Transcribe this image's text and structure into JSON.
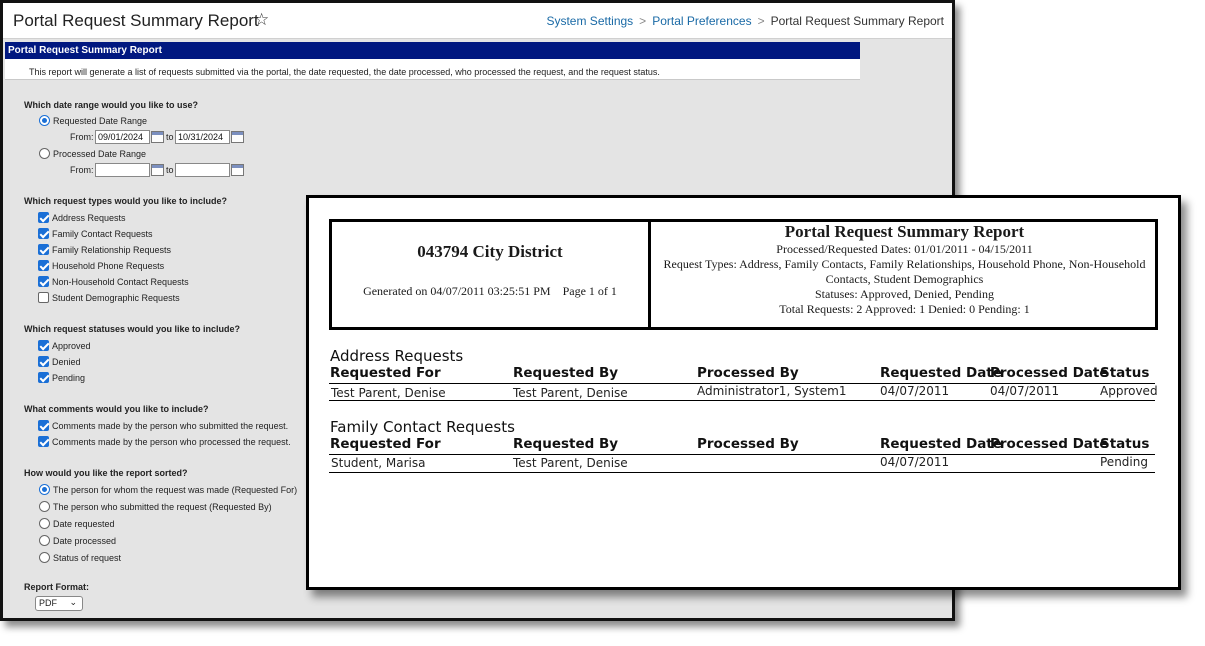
{
  "form_window": {
    "title": "Portal Request Summary Report",
    "star_icon": "star-outline-icon",
    "breadcrumb": [
      "System Settings",
      "Portal Preferences",
      "Portal Request Summary Report"
    ],
    "panel_title": "Portal Request Summary Report",
    "description": "This report will generate a list of requests submitted via the portal, the date requested, the date processed, who processed the request, and the request status.",
    "date_range": {
      "question": "Which date range would you like to use?",
      "requested_label": "Requested Date Range",
      "processed_label": "Processed Date Range",
      "from_label": "From:",
      "to_label": "to",
      "requested_from": "09/01/2024",
      "requested_to": "10/31/2024",
      "processed_from": "",
      "processed_to": "",
      "selected": "requested"
    },
    "request_types": {
      "question": "Which request types would you like to include?",
      "items": [
        {
          "label": "Address Requests",
          "checked": true
        },
        {
          "label": "Family Contact Requests",
          "checked": true
        },
        {
          "label": "Family Relationship Requests",
          "checked": true
        },
        {
          "label": "Household Phone Requests",
          "checked": true
        },
        {
          "label": "Non-Household Contact Requests",
          "checked": true
        },
        {
          "label": "Student Demographic Requests",
          "checked": false
        }
      ]
    },
    "statuses": {
      "question": "Which request statuses would you like to include?",
      "items": [
        {
          "label": "Approved",
          "checked": true
        },
        {
          "label": "Denied",
          "checked": true
        },
        {
          "label": "Pending",
          "checked": true
        }
      ]
    },
    "comments": {
      "question": "What comments would you like to include?",
      "items": [
        {
          "label": "Comments made by the person who submitted the request.",
          "checked": true
        },
        {
          "label": "Comments made by the person who processed the request.",
          "checked": true
        }
      ]
    },
    "sort": {
      "question": "How would you like the report sorted?",
      "items": [
        {
          "label": "The person for whom the request was made (Requested For)",
          "selected": true
        },
        {
          "label": "The person who submitted the request (Requested By)",
          "selected": false
        },
        {
          "label": "Date requested",
          "selected": false
        },
        {
          "label": "Date processed",
          "selected": false
        },
        {
          "label": "Status of request",
          "selected": false
        }
      ]
    },
    "report_format": {
      "label": "Report Format:",
      "value": "PDF"
    },
    "colors": {
      "title_bar": "#011880",
      "link": "#1a6aa6",
      "checked": "#1a6fd6",
      "panel_bg": "#e4e4e4"
    }
  },
  "report_window": {
    "district": "043794  City District",
    "generated": "Generated on 04/07/2011 03:25:51 PM",
    "page": "Page 1 of  1",
    "title": "Portal Request Summary Report",
    "dates_line": "Processed/Requested Dates: 01/01/2011 - 04/15/2011",
    "types_line1": "Request Types: Address, Family Contacts, Family Relationships, Household Phone, Non-Household",
    "types_line2": "Contacts, Student Demographics",
    "statuses_line": "Statuses: Approved, Denied, Pending",
    "totals_line": "Total Requests: 2 Approved: 1 Denied: 0 Pending: 1",
    "columns": [
      "Requested For",
      "Requested By",
      "Processed By",
      "Requested Date",
      "Processed Date",
      "Status"
    ],
    "sections": [
      {
        "title": "Address Requests",
        "rows": [
          [
            "Test Parent, Denise",
            "Test Parent, Denise",
            "Administrator1, System1",
            "04/07/2011",
            "04/07/2011",
            "Approved"
          ]
        ]
      },
      {
        "title": "Family Contact Requests",
        "rows": [
          [
            "Student, Marisa",
            "Test Parent, Denise",
            "",
            "04/07/2011",
            "",
            "Pending"
          ]
        ]
      }
    ]
  }
}
